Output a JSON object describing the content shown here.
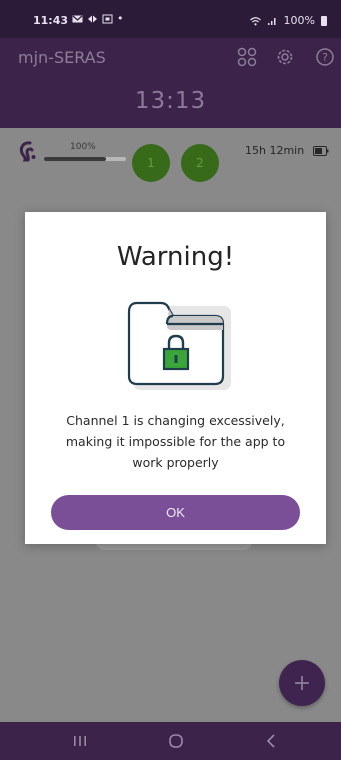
{
  "status_bar": {
    "time": "11:43",
    "dot": "•",
    "battery_text": "100%",
    "icons": [
      "mail-icon",
      "data-saver-icon",
      "screenshot-icon",
      "wifi-icon",
      "signal-icon",
      "battery-icon"
    ]
  },
  "header": {
    "app_title": "mjn-SERAS",
    "clock": "13:13",
    "icons": [
      "grid-icon",
      "gear-icon",
      "help-icon"
    ]
  },
  "device": {
    "volume_label": "100%",
    "volume_fraction": 0.75,
    "programs": [
      "1",
      "2"
    ],
    "battery_time": "15h 12min",
    "program_color": "#376a19"
  },
  "dialog": {
    "title": "Warning!",
    "message": "Channel 1 is changing excessively, making it impossible for the app to work properly",
    "ok_label": "OK",
    "illustration": "locked-folder-icon"
  },
  "fab": {
    "label": "+"
  },
  "nav": {
    "icons": [
      "recents-icon",
      "home-icon",
      "back-icon"
    ]
  },
  "colors": {
    "primary": "#3c2349",
    "accent": "#7a4f97",
    "lock": "#3aa63a"
  }
}
